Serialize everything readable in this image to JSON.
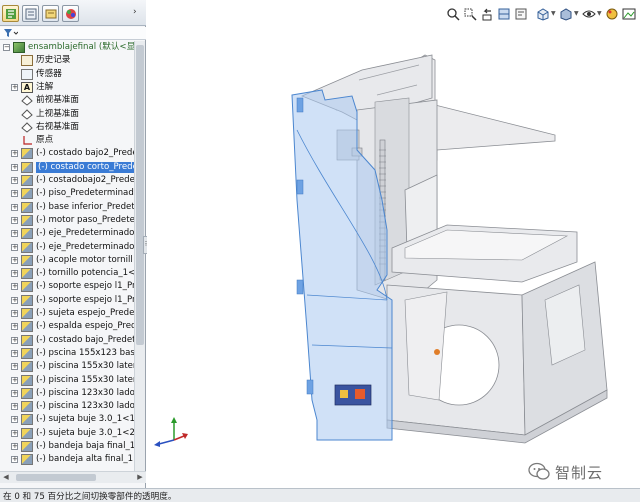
{
  "feature_tree": {
    "items": [
      {
        "label": "ensamblajefinal  (默认<显",
        "icon": "assembly-icon",
        "expander": "−",
        "selected": false
      },
      {
        "label": "历史记录",
        "icon": "history-icon",
        "expander": "",
        "selected": false
      },
      {
        "label": "传感器",
        "icon": "sensors-icon",
        "expander": "",
        "selected": false
      },
      {
        "label": "注解",
        "icon": "annotations-icon",
        "expander": "+",
        "selected": false
      },
      {
        "label": "前视基准面",
        "icon": "plane-icon",
        "expander": "",
        "selected": false
      },
      {
        "label": "上视基准面",
        "icon": "plane-icon",
        "expander": "",
        "selected": false
      },
      {
        "label": "右视基准面",
        "icon": "plane-icon",
        "expander": "",
        "selected": false
      },
      {
        "label": "原点",
        "icon": "origin-icon",
        "expander": "",
        "selected": false
      },
      {
        "label": "(-) costado bajo2_Predet",
        "icon": "part-icon",
        "expander": "+",
        "selected": false
      },
      {
        "label": "(-) costado corto_Prede",
        "icon": "part-icon",
        "expander": "+",
        "selected": true
      },
      {
        "label": "(-) costadobajo2_Prede",
        "icon": "part-icon",
        "expander": "+",
        "selected": false
      },
      {
        "label": "(-) piso_Predeterminado",
        "icon": "part-icon",
        "expander": "+",
        "selected": false
      },
      {
        "label": "(-) base inferior_Predet",
        "icon": "part-icon",
        "expander": "+",
        "selected": false
      },
      {
        "label": "(-) motor paso_Predete",
        "icon": "part-icon",
        "expander": "+",
        "selected": false
      },
      {
        "label": "(-) eje_Predeterminado-",
        "icon": "part-icon",
        "expander": "+",
        "selected": false
      },
      {
        "label": "(-) eje_Predeterminado-",
        "icon": "part-icon",
        "expander": "+",
        "selected": false
      },
      {
        "label": "(-) acople motor tornill",
        "icon": "part-icon",
        "expander": "+",
        "selected": false
      },
      {
        "label": "(-) tornillo potencia_1<",
        "icon": "part-icon",
        "expander": "+",
        "selected": false
      },
      {
        "label": "(-) soporte espejo l1_Pr",
        "icon": "part-icon",
        "expander": "+",
        "selected": false
      },
      {
        "label": "(-) soporte espejo l1_Pr",
        "icon": "part-icon",
        "expander": "+",
        "selected": false
      },
      {
        "label": "(-) sujeta espejo_Predet",
        "icon": "part-icon",
        "expander": "+",
        "selected": false
      },
      {
        "label": "(-) espalda espejo_Pred",
        "icon": "part-icon",
        "expander": "+",
        "selected": false
      },
      {
        "label": "(-) costado bajo_Predet",
        "icon": "part-icon",
        "expander": "+",
        "selected": false
      },
      {
        "label": "(-) pscina 155x123 base",
        "icon": "part-icon",
        "expander": "+",
        "selected": false
      },
      {
        "label": "(-) piscina 155x30 latera",
        "icon": "part-icon",
        "expander": "+",
        "selected": false
      },
      {
        "label": "(-) piscina 155x30 latera",
        "icon": "part-icon",
        "expander": "+",
        "selected": false
      },
      {
        "label": "(-) piscina 123x30 lado2",
        "icon": "part-icon",
        "expander": "+",
        "selected": false
      },
      {
        "label": "(-) piscina 123x30 lado2",
        "icon": "part-icon",
        "expander": "+",
        "selected": false
      },
      {
        "label": "(-) sujeta buje 3.0_1<1>",
        "icon": "part-icon",
        "expander": "+",
        "selected": false
      },
      {
        "label": "(-) sujeta buje 3.0_1<2>",
        "icon": "part-icon",
        "expander": "+",
        "selected": false
      },
      {
        "label": "(-) bandeja baja final_1-",
        "icon": "part-icon",
        "expander": "+",
        "selected": false
      },
      {
        "label": "(-) bandeja alta final_1<",
        "icon": "part-icon",
        "expander": "+",
        "selected": false
      }
    ]
  },
  "panel_tabs": [
    "feature-manager-tab",
    "property-manager-tab",
    "configuration-manager-tab",
    "appearance-tab"
  ],
  "view_toolbar": [
    "zoom-to-fit-icon",
    "zoom-to-area-icon",
    "previous-view-icon",
    "section-view-icon",
    "view-orientation-icon",
    "display-style-icon",
    "hide-show-icon",
    "edit-appearance-icon",
    "scene-icon"
  ],
  "watermark": {
    "text": "智制云"
  },
  "status_bar": {
    "text": "在 0 和 75 百分比之间切换零部件的透明度。"
  },
  "colors": {
    "selection": "#3a7bd5",
    "transparent_part": "#a9c8f0",
    "model_gray": "#e4e5e8"
  }
}
